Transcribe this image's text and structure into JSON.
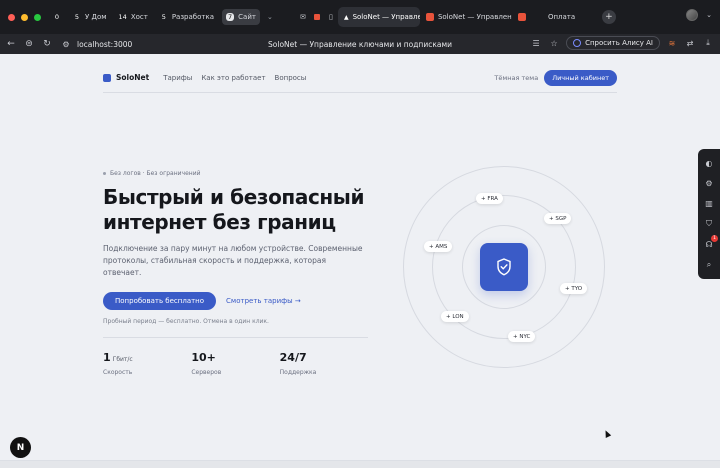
{
  "browser": {
    "workspaces": [
      {
        "num": "0",
        "label": ""
      },
      {
        "num": "5",
        "label": "У Дом"
      },
      {
        "num": "14",
        "label": "Хост"
      },
      {
        "num": "5",
        "label": "Разработка"
      },
      {
        "num": "7",
        "label": "Сайт"
      }
    ],
    "tabs": [
      {
        "label": "SoloNet — Управлени"
      },
      {
        "label": "SoloNet — Управление к"
      },
      {
        "label": "Оплата"
      }
    ],
    "url": "localhost:3000",
    "title": "SoloNet — Управление ключами и подписками",
    "alice_label": "Спросить Алису AI",
    "notif_count": "1"
  },
  "site": {
    "logo": "SoloNet",
    "nav": [
      "Тарифы",
      "Как это работает",
      "Вопросы"
    ],
    "theme_label": "Тёмная тема",
    "cabinet_label": "Личный кабинет"
  },
  "hero": {
    "eyebrow": "Без логов · Без ограничений",
    "headline_line1": "Быстрый и безопасный",
    "headline_line2": "интернет без границ",
    "subtitle": "Подключение за пару минут на любом устройстве. Современные протоколы, стабильная скорость и поддержка, которая отвечает.",
    "cta_primary": "Попробовать бесплатно",
    "cta_secondary": "Смотреть тарифы →",
    "trial_note": "Пробный период — бесплатно. Отмена в один клик."
  },
  "stats": [
    {
      "value": "1",
      "unit": "Гбит/с",
      "label": "Скорость"
    },
    {
      "value": "10+",
      "unit": "",
      "label": "Серверов"
    },
    {
      "value": "24/7",
      "unit": "",
      "label": "Поддержка"
    }
  ],
  "locations": [
    "+ FRA",
    "+ SGP",
    "+ AMS",
    "+ TYO",
    "+ LON",
    "+ NYC"
  ],
  "next_badge": "N",
  "colors": {
    "accent": "#3a5bc7",
    "page_bg": "#eef0f4"
  }
}
